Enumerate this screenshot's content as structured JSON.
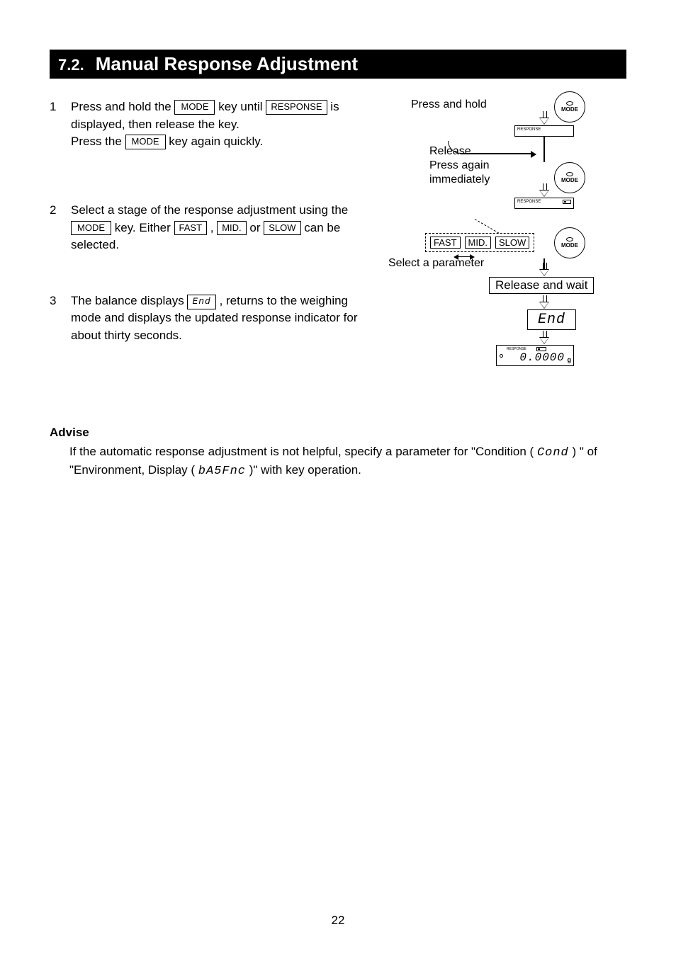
{
  "section": {
    "number": "7.2.",
    "title": "Manual Response Adjustment"
  },
  "steps": [
    {
      "num": "1",
      "parts": {
        "a1": "Press and hold the ",
        "k1": "MODE",
        "a2": " key until ",
        "k2": "RESPONSE",
        "a3": " is displayed, then release the key.",
        "b1": "Press the ",
        "k3": "MODE",
        "b2": " key again quickly."
      }
    },
    {
      "num": "2",
      "parts": {
        "a1": "Select a stage of the response adjustment using the ",
        "k1": "MODE",
        "a2": " key. Either ",
        "k2": "FAST",
        "a3": ", ",
        "k3": "MID.",
        "a4": " or ",
        "k4": "SLOW",
        "a5": " can be selected."
      }
    },
    {
      "num": "3",
      "parts": {
        "a1": "The balance displays ",
        "k1": "End",
        "a2": ", returns to the weighing mode and displays the updated response indicator for about thirty seconds."
      }
    }
  ],
  "advise": {
    "title": "Advise",
    "t1": "If the automatic response adjustment is not helpful, specify a parameter for \"Condition (",
    "seg1": "Cond",
    "t2": ") \" of \"Environment, Display (",
    "seg2": "bA5Fnc",
    "t3": " )\" with key operation."
  },
  "diagram": {
    "press_hold": "Press and hold",
    "mode_label": "MODE",
    "response_small": "RESPONSE",
    "release": "Release",
    "press_again": "Press again",
    "immediately": "immediately",
    "fast": "FAST",
    "mid": "MID.",
    "slow": "SLOW",
    "select_param": "Select a parameter",
    "release_wait": "Release and wait",
    "end": "End",
    "lcd_value": "0.0000",
    "lcd_unit": "g",
    "lcd_resp": "RESPONSE"
  },
  "footer": {
    "page": "22"
  }
}
